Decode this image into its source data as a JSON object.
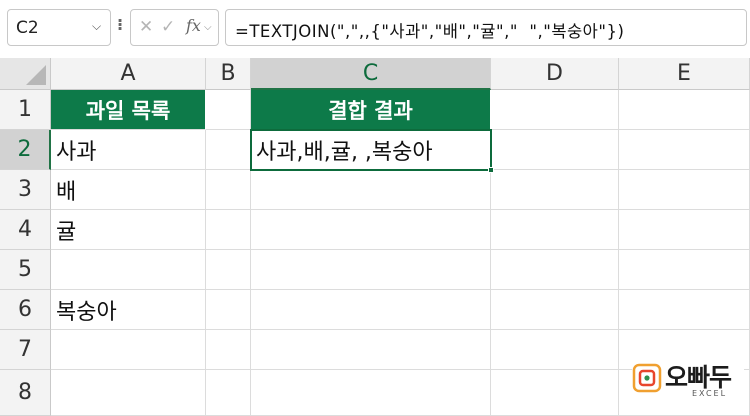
{
  "formula_bar": {
    "name_box": "C2",
    "fx_label": "fx",
    "formula": "=TEXTJOIN(\",\",,{\"사과\",\"배\",\"귤\",\"  \",\"복숭아\"})"
  },
  "columns": [
    "A",
    "B",
    "C",
    "D",
    "E"
  ],
  "rows": [
    "1",
    "2",
    "3",
    "4",
    "5",
    "6",
    "7",
    "8"
  ],
  "cells": {
    "A1": "과일 목록",
    "A2": "사과",
    "A3": "배",
    "A4": "귤",
    "A5": "",
    "A6": "복숭아",
    "C1": "결합 결과",
    "C2": "사과,배,귤, ,복숭아"
  },
  "selection": {
    "active_cell": "C2",
    "column": "C",
    "row": "2"
  },
  "colors": {
    "header_fill": "#0d7a49",
    "accent": "#217346"
  },
  "logo": {
    "name": "오빠두",
    "sub": "EXCEL"
  }
}
